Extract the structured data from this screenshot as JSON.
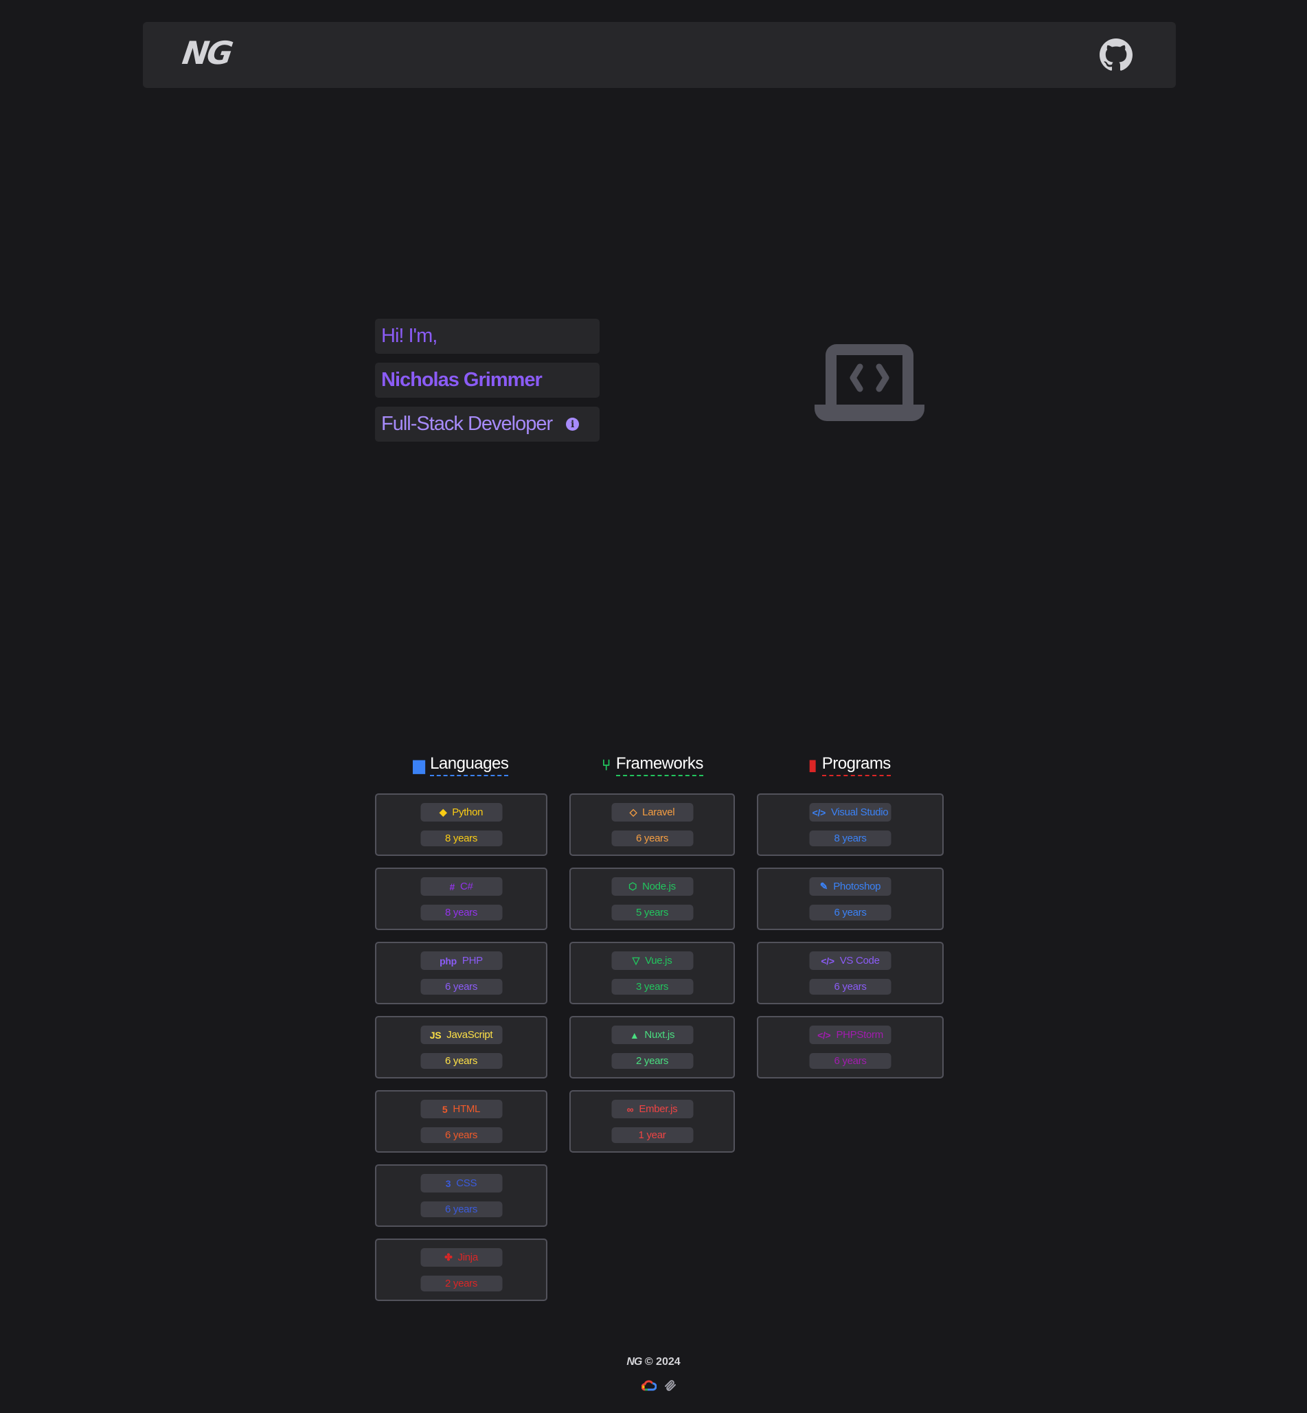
{
  "header": {
    "logo": "NG",
    "github_icon": "github-icon"
  },
  "hero": {
    "greeting": "Hi! I'm,",
    "name": "Nicholas Grimmer",
    "role": "Full-Stack Developer",
    "info_icon": "i",
    "illustration": "laptop-code-icon"
  },
  "colors": {
    "accent": "#8b5cf6",
    "background": "#18181b",
    "surface": "#27272a"
  },
  "sections": [
    {
      "title": "Languages",
      "icon": "language-icon",
      "color": "#3b82f6",
      "items": [
        {
          "name": "Python",
          "years": "8 years",
          "icon": "python-icon",
          "glyph": "◆",
          "color": "#facc15"
        },
        {
          "name": "C#",
          "years": "8 years",
          "icon": "hashtag-icon",
          "glyph": "#",
          "color": "#9333ea"
        },
        {
          "name": "PHP",
          "years": "6 years",
          "icon": "php-icon",
          "glyph": "php",
          "color": "#8b5cf6"
        },
        {
          "name": "JavaScript",
          "years": "6 years",
          "icon": "js-icon",
          "glyph": "JS",
          "color": "#fde047"
        },
        {
          "name": "HTML",
          "years": "6 years",
          "icon": "html5-icon",
          "glyph": "5",
          "color": "#f05a2a"
        },
        {
          "name": "CSS",
          "years": "6 years",
          "icon": "css3-icon",
          "glyph": "3",
          "color": "#3b5bdb"
        },
        {
          "name": "Jinja",
          "years": "2 years",
          "icon": "jinja-icon",
          "glyph": "✤",
          "color": "#dc2626"
        }
      ]
    },
    {
      "title": "Frameworks",
      "icon": "code-branch-icon",
      "color": "#22c55e",
      "items": [
        {
          "name": "Laravel",
          "years": "6 years",
          "icon": "laravel-icon",
          "glyph": "◇",
          "color": "#f59e42"
        },
        {
          "name": "Node.js",
          "years": "5 years",
          "icon": "nodejs-icon",
          "glyph": "⬡",
          "color": "#22c55e"
        },
        {
          "name": "Vue.js",
          "years": "3 years",
          "icon": "vuejs-icon",
          "glyph": "▽",
          "color": "#22c55e"
        },
        {
          "name": "Nuxt.js",
          "years": "2 years",
          "icon": "mountain-icon",
          "glyph": "▲",
          "color": "#4ade80"
        },
        {
          "name": "Ember.js",
          "years": "1 year",
          "icon": "glasses-icon",
          "glyph": "∞",
          "color": "#ef4444"
        }
      ]
    },
    {
      "title": "Programs",
      "icon": "file-icon",
      "color": "#dc2626",
      "items": [
        {
          "name": "Visual Studio",
          "years": "8 years",
          "icon": "code-icon",
          "glyph": "</>",
          "color": "#3b82f6"
        },
        {
          "name": "Photoshop",
          "years": "6 years",
          "icon": "paintbrush-icon",
          "glyph": "✎",
          "color": "#3b82f6"
        },
        {
          "name": "VS Code",
          "years": "6 years",
          "icon": "code-icon",
          "glyph": "</>",
          "color": "#8b5cf6"
        },
        {
          "name": "PHPStorm",
          "years": "6 years",
          "icon": "code-icon",
          "glyph": "</>",
          "color": "#a21caf"
        }
      ]
    }
  ],
  "footer": {
    "logo": "NG",
    "copyright": "© 2024",
    "icons": [
      "google-cloud-icon",
      "squarespace-icon"
    ]
  }
}
